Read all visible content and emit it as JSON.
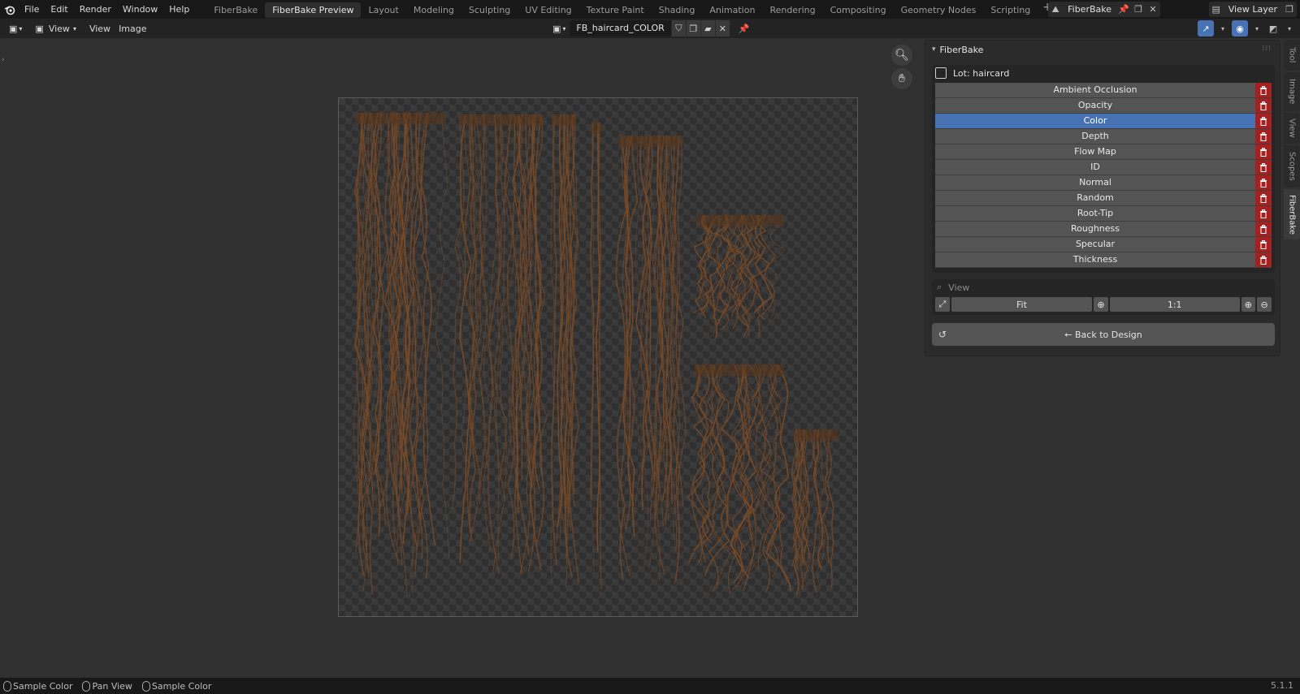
{
  "menubar": {
    "items": [
      "File",
      "Edit",
      "Render",
      "Window",
      "Help"
    ],
    "workspaces": [
      "FiberBake",
      "FiberBake Preview",
      "Layout",
      "Modeling",
      "Sculpting",
      "UV Editing",
      "Texture Paint",
      "Shading",
      "Animation",
      "Rendering",
      "Compositing",
      "Geometry Nodes",
      "Scripting"
    ],
    "active_workspace": "FiberBake Preview",
    "add_workspace_icon": "plus-icon",
    "scene_name": "FiberBake",
    "view_layer": "View Layer"
  },
  "editor_header": {
    "view_mode": "View",
    "menus": [
      "View",
      "Image"
    ],
    "image_name": "FB_haircard_COLOR"
  },
  "npanel": {
    "title": "FiberBake",
    "lot_label": "Lot: haircard",
    "passes": [
      "Ambient Occlusion",
      "Opacity",
      "Color",
      "Depth",
      "Flow Map",
      "ID",
      "Normal",
      "Random",
      "Root-Tip",
      "Roughness",
      "Specular",
      "Thickness"
    ],
    "selected_pass": "Color",
    "view_section": {
      "label": "View",
      "fit": "Fit",
      "one_to_one": "1:1"
    },
    "back_button": "← Back to Design"
  },
  "side_tabs": [
    "Tool",
    "Image",
    "View",
    "Scopes",
    "FiberBake"
  ],
  "active_side_tab": "FiberBake",
  "statusbar": {
    "items": [
      "Sample Color",
      "Pan View",
      "Sample Color"
    ],
    "version": "5.1.1"
  },
  "colors": {
    "accent": "#4772b3",
    "delete": "#a52020",
    "hair": "#7a4a26"
  }
}
